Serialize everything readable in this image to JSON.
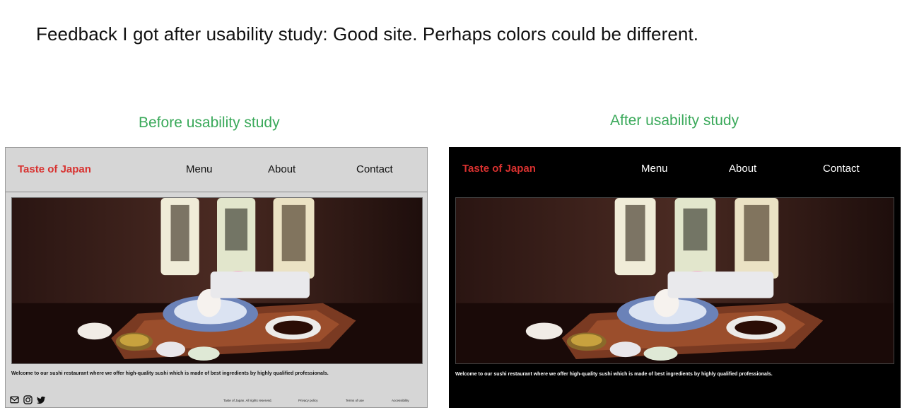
{
  "headline": "Feedback I got after usability study: Good site. Perhaps colors could be different.",
  "before_label": "Before usability study",
  "after_label": "After usability study",
  "site": {
    "brand": "Taste of Japan",
    "nav": [
      "Menu",
      "About",
      "Contact"
    ],
    "welcome": "Welcome to our sushi restaurant where we offer high-quality sushi which is made of best ingredients by highly qualified professionals.",
    "footer_links": [
      "Taste of Japan. All rights reserved.",
      "Privacy policy",
      "Terms of use",
      "Accessibility"
    ],
    "footer_icons": [
      "mail-icon",
      "instagram-icon",
      "twitter-icon"
    ]
  },
  "colors": {
    "label_green": "#3aa95a",
    "brand_red": "#d8312f",
    "before_background": "#d6d6d6",
    "after_background": "#000000"
  }
}
